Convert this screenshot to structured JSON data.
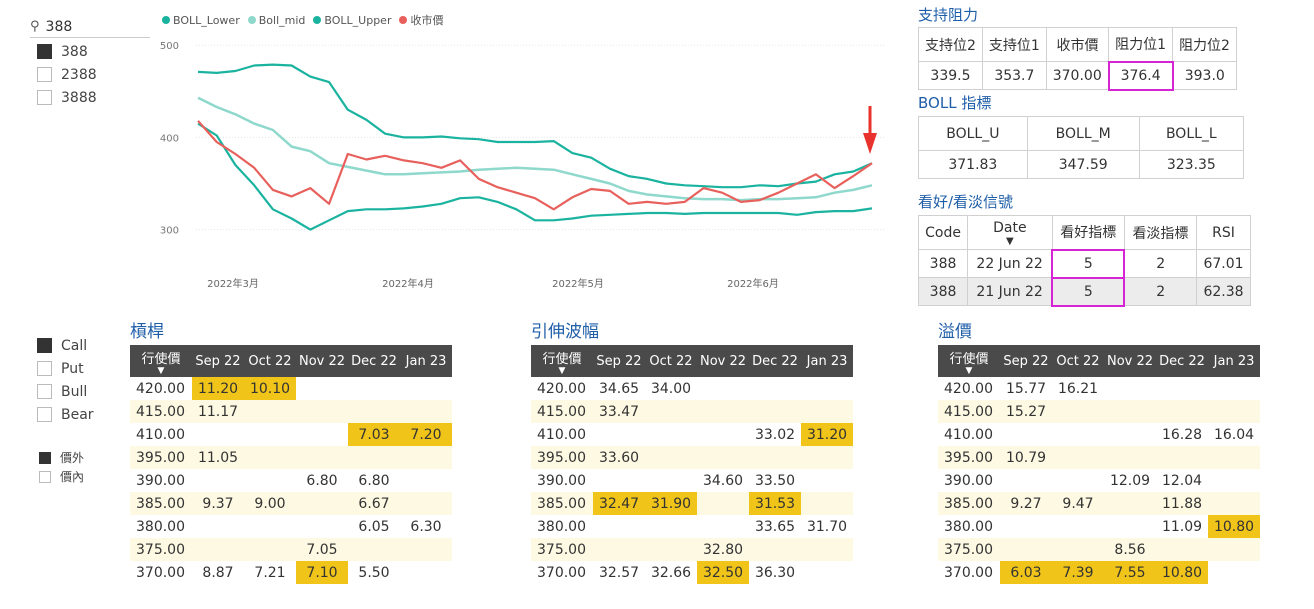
{
  "slicer": {
    "search_value": "388",
    "items": [
      {
        "label": "388",
        "checked": true
      },
      {
        "label": "2388",
        "checked": false
      },
      {
        "label": "3888",
        "checked": false
      }
    ]
  },
  "chart_data": {
    "type": "line",
    "legend": [
      "BOLL_Lower",
      "Boll_mid",
      "BOLL_Upper",
      "收市價"
    ],
    "series": [
      {
        "name": "BOLL_Upper",
        "color": "#1ab39f",
        "values": [
          471,
          470,
          472,
          478,
          479,
          478,
          466,
          460,
          430,
          419,
          404,
          400,
          400,
          401,
          399,
          398,
          395,
          395,
          395,
          396,
          383,
          378,
          366,
          358,
          355,
          350,
          348,
          347,
          346,
          346,
          348,
          347,
          350,
          352,
          360,
          363,
          372
        ]
      },
      {
        "name": "Boll_mid",
        "color": "#8ed8cc",
        "values": [
          443,
          433,
          425,
          415,
          408,
          390,
          385,
          372,
          368,
          364,
          360,
          360,
          361,
          362,
          363,
          365,
          366,
          367,
          366,
          365,
          360,
          355,
          350,
          342,
          338,
          336,
          334,
          333,
          333,
          332,
          333,
          333,
          334,
          335,
          340,
          343,
          348
        ]
      },
      {
        "name": "BOLL_Lower",
        "color": "#1ab39f",
        "values": [
          415,
          402,
          370,
          348,
          322,
          312,
          300,
          310,
          320,
          322,
          322,
          323,
          325,
          328,
          334,
          335,
          330,
          322,
          310,
          310,
          312,
          315,
          316,
          317,
          318,
          318,
          317,
          318,
          318,
          318,
          318,
          318,
          316,
          319,
          320,
          320,
          323
        ]
      },
      {
        "name": "收市價",
        "color": "#e8605c",
        "values": [
          418,
          395,
          382,
          367,
          343,
          336,
          345,
          328,
          382,
          376,
          380,
          375,
          372,
          367,
          375,
          355,
          346,
          340,
          334,
          322,
          335,
          344,
          342,
          328,
          330,
          328,
          330,
          345,
          340,
          330,
          332,
          340,
          350,
          360,
          345,
          358,
          372
        ]
      }
    ],
    "x_ticks": [
      "2022年3月",
      "2022年4月",
      "2022年5月",
      "2022年6月"
    ],
    "y_ticks": [
      500,
      400,
      300
    ],
    "ylim": [
      280,
      510
    ]
  },
  "support": {
    "title": "支持阻力",
    "headers": [
      "支持位2",
      "支持位1",
      "收市價",
      "阻力位1",
      "阻力位2"
    ],
    "values": [
      "339.5",
      "353.7",
      "370.00",
      "376.4",
      "393.0"
    ]
  },
  "boll": {
    "title": "BOLL 指標",
    "headers": [
      "BOLL_U",
      "BOLL_M",
      "BOLL_L"
    ],
    "values": [
      "371.83",
      "347.59",
      "323.35"
    ]
  },
  "signals": {
    "title": "看好/看淡信號",
    "headers": [
      "Code",
      "Date",
      "看好指標",
      "看淡指標",
      "RSI"
    ],
    "rows": [
      [
        "388",
        "22 Jun 22",
        "5",
        "2",
        "67.01"
      ],
      [
        "388",
        "21 Jun 22",
        "5",
        "2",
        "62.38"
      ]
    ]
  },
  "option_types": [
    {
      "label": "Call",
      "checked": true
    },
    {
      "label": "Put",
      "checked": false
    },
    {
      "label": "Bull",
      "checked": false
    },
    {
      "label": "Bear",
      "checked": false
    }
  ],
  "money": [
    {
      "label": "價外",
      "checked": true
    },
    {
      "label": "價內",
      "checked": false
    }
  ],
  "matrix_headers": [
    "行使價",
    "Sep 22",
    "Oct 22",
    "Nov 22",
    "Dec 22",
    "Jan 23"
  ],
  "matrices": [
    {
      "title": "槓桿",
      "rows": [
        [
          "420.00",
          "11.20",
          "10.10",
          "",
          "",
          ""
        ],
        [
          "415.00",
          "11.17",
          "",
          "",
          "",
          ""
        ],
        [
          "410.00",
          "",
          "",
          "",
          "7.03",
          "7.20"
        ],
        [
          "395.00",
          "11.05",
          "",
          "",
          "",
          ""
        ],
        [
          "390.00",
          "",
          "",
          "6.80",
          "6.80",
          ""
        ],
        [
          "385.00",
          "9.37",
          "9.00",
          "",
          "6.67",
          ""
        ],
        [
          "380.00",
          "",
          "",
          "",
          "6.05",
          "6.30"
        ],
        [
          "375.00",
          "",
          "",
          "7.05",
          "",
          ""
        ],
        [
          "370.00",
          "8.87",
          "7.21",
          "7.10",
          "5.50",
          ""
        ]
      ],
      "highlights": [
        "0-1",
        "0-2",
        "2-4",
        "2-5",
        "8-3"
      ]
    },
    {
      "title": "引伸波幅",
      "rows": [
        [
          "420.00",
          "34.65",
          "34.00",
          "",
          "",
          ""
        ],
        [
          "415.00",
          "33.47",
          "",
          "",
          "",
          ""
        ],
        [
          "410.00",
          "",
          "",
          "",
          "33.02",
          "31.20"
        ],
        [
          "395.00",
          "33.60",
          "",
          "",
          "",
          ""
        ],
        [
          "390.00",
          "",
          "",
          "34.60",
          "33.50",
          ""
        ],
        [
          "385.00",
          "32.47",
          "31.90",
          "",
          "31.53",
          ""
        ],
        [
          "380.00",
          "",
          "",
          "",
          "33.65",
          "31.70"
        ],
        [
          "375.00",
          "",
          "",
          "32.80",
          "",
          ""
        ],
        [
          "370.00",
          "32.57",
          "32.66",
          "32.50",
          "36.30",
          ""
        ]
      ],
      "highlights": [
        "2-5",
        "5-1",
        "5-2",
        "5-4",
        "8-3"
      ]
    },
    {
      "title": "溢價",
      "rows": [
        [
          "420.00",
          "15.77",
          "16.21",
          "",
          "",
          ""
        ],
        [
          "415.00",
          "15.27",
          "",
          "",
          "",
          ""
        ],
        [
          "410.00",
          "",
          "",
          "",
          "16.28",
          "16.04"
        ],
        [
          "395.00",
          "10.79",
          "",
          "",
          "",
          ""
        ],
        [
          "390.00",
          "",
          "",
          "12.09",
          "12.04",
          ""
        ],
        [
          "385.00",
          "9.27",
          "9.47",
          "",
          "11.88",
          ""
        ],
        [
          "380.00",
          "",
          "",
          "",
          "11.09",
          "10.80"
        ],
        [
          "375.00",
          "",
          "",
          "8.56",
          "",
          ""
        ],
        [
          "370.00",
          "6.03",
          "7.39",
          "7.55",
          "10.80",
          ""
        ]
      ],
      "highlights": [
        "6-5",
        "8-1",
        "8-2",
        "8-3",
        "8-4"
      ]
    }
  ]
}
